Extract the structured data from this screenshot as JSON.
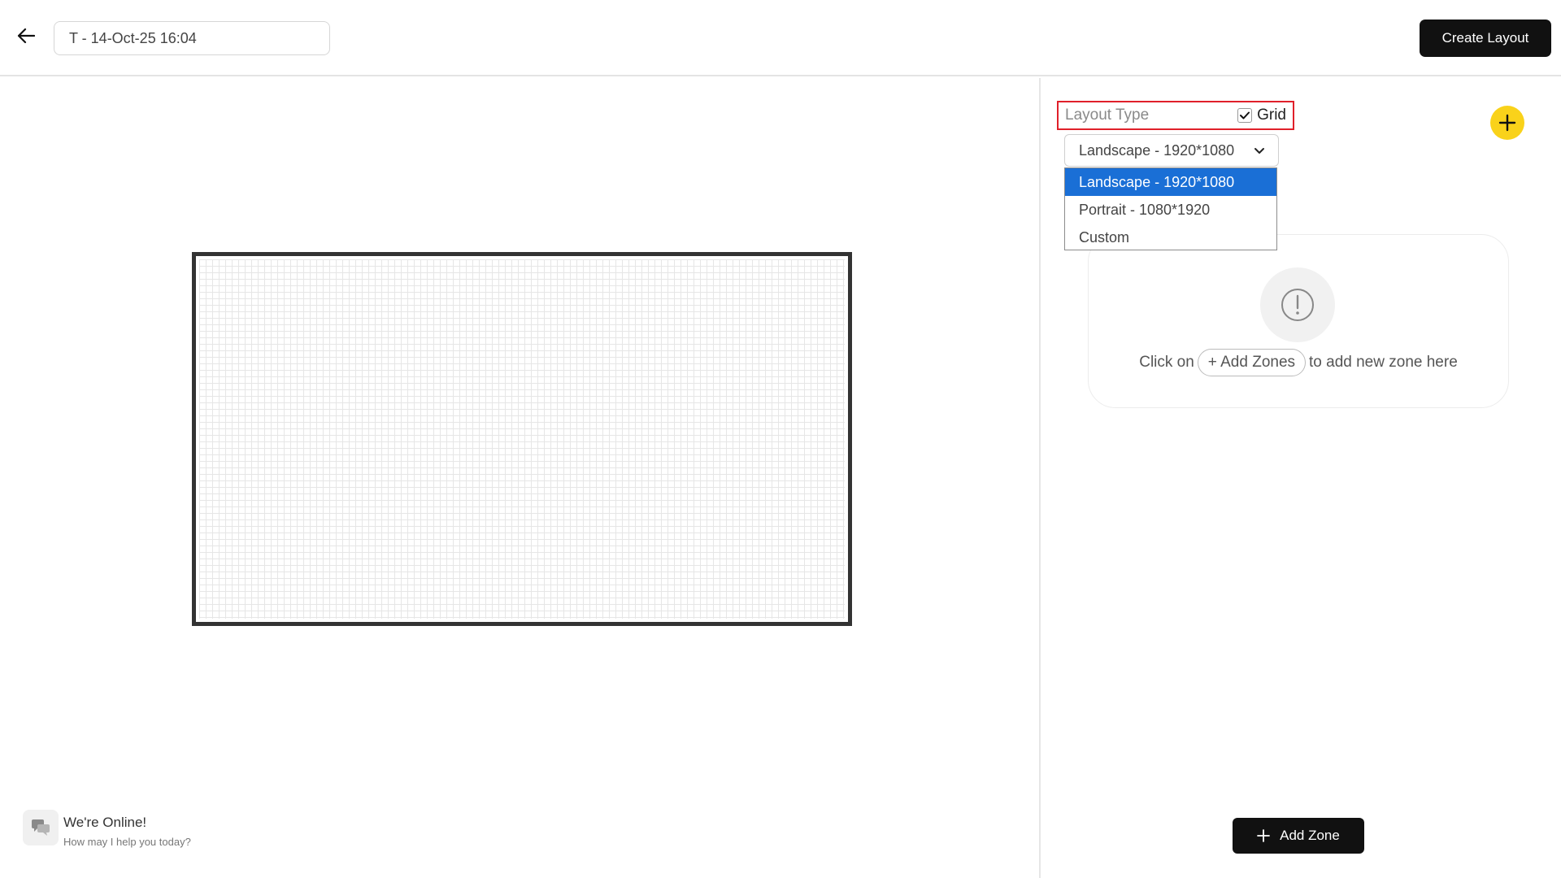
{
  "header": {
    "layout_name_value": "T - 14-Oct-25 16:04",
    "create_label": "Create Layout"
  },
  "panel": {
    "layout_type_label": "Layout Type",
    "grid_label": "Grid",
    "grid_checked": true,
    "select": {
      "value": "Landscape - 1920*1080",
      "options": [
        "Landscape - 1920*1080",
        "Portrait - 1080*1920",
        "Custom"
      ]
    },
    "empty_state": {
      "prefix": "Click on",
      "pill": "+ Add Zones",
      "suffix": "to add new zone here"
    },
    "add_zone_label": "Add Zone"
  },
  "chat": {
    "title": "We're Online!",
    "subtitle": "How may I help you today?"
  },
  "colors": {
    "accent_yellow": "#f9d21a",
    "selected_blue": "#1a6fd6",
    "highlight_red": "#e0202a",
    "dark_button": "#111111"
  },
  "icons": {
    "back": "arrow-left-icon",
    "check": "check-icon",
    "plus": "plus-icon",
    "chevron": "chevron-down-icon",
    "warning": "exclamation-circle-icon",
    "chat": "chat-bubbles-icon"
  }
}
